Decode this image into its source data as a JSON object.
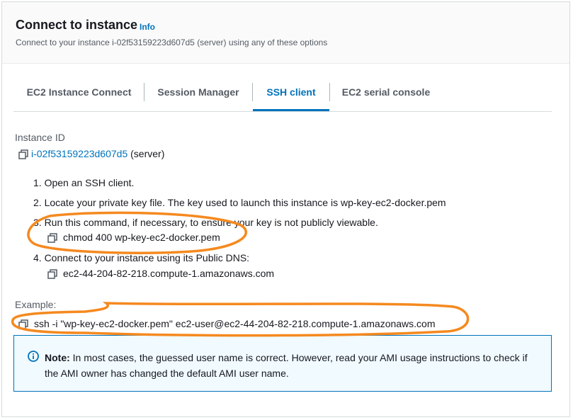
{
  "header": {
    "title": "Connect to instance",
    "info_link": "Info",
    "subtitle": "Connect to your instance i-02f53159223d607d5 (server) using any of these options"
  },
  "tabs": [
    {
      "label": "EC2 Instance Connect",
      "active": false
    },
    {
      "label": "Session Manager",
      "active": false
    },
    {
      "label": "SSH client",
      "active": true
    },
    {
      "label": "EC2 serial console",
      "active": false
    }
  ],
  "instance": {
    "label": "Instance ID",
    "id": "i-02f53159223d607d5",
    "suffix": "(server)"
  },
  "steps": [
    {
      "text": "1. Open an SSH client."
    },
    {
      "text": "2. Locate your private key file. The key used to launch this instance is wp-key-ec2-docker.pem"
    },
    {
      "text": "3. Run this command, if necessary, to ensure your key is not publicly viewable.",
      "command": "chmod 400 wp-key-ec2-docker.pem"
    },
    {
      "text": "4. Connect to your instance using its Public DNS:",
      "command": "ec2-44-204-82-218.compute-1.amazonaws.com"
    }
  ],
  "example": {
    "label": "Example:",
    "command": "ssh -i \"wp-key-ec2-docker.pem\" ec2-user@ec2-44-204-82-218.compute-1.amazonaws.com"
  },
  "note": {
    "label": "Note:",
    "text": " In most cases, the guessed user name is correct. However, read your AMI usage instructions to check if the AMI owner has changed the default AMI user name."
  },
  "colors": {
    "accent": "#0073bb",
    "annotation": "#f5891f",
    "info_bg": "#f1faff"
  }
}
